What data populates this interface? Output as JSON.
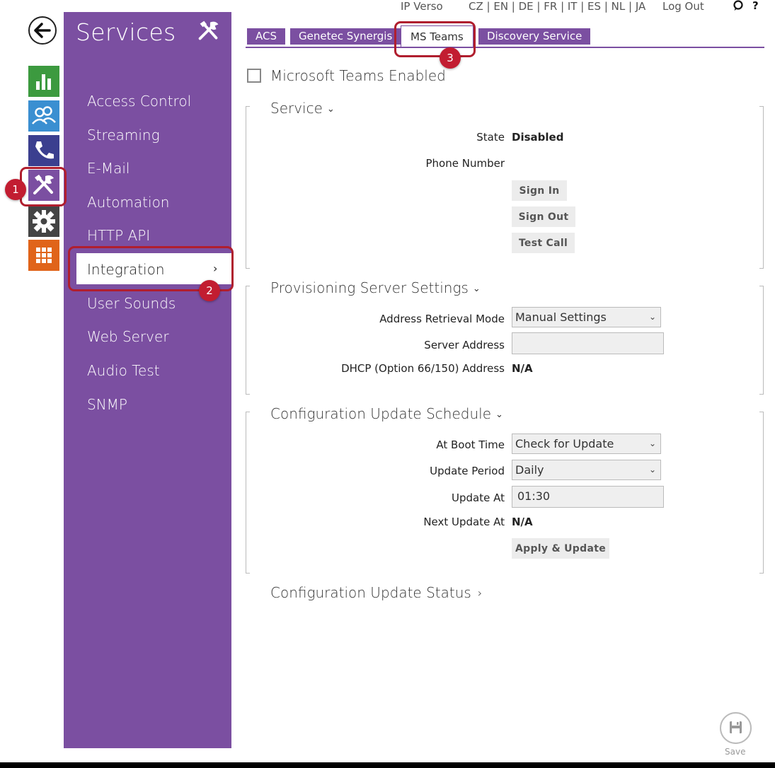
{
  "topbar": {
    "product": "IP Verso",
    "languages": "CZ | EN | DE | FR | IT | ES | NL | JA",
    "logout": "Log Out",
    "feedback_icon": "speech-bubble-icon",
    "help": "?"
  },
  "rail": {
    "back_icon": "back-arrow-icon",
    "items": [
      {
        "icon": "status-chart-icon",
        "color": "#3c9a3f"
      },
      {
        "icon": "directory-users-icon",
        "color": "#3a8fd1"
      },
      {
        "icon": "phone-icon",
        "color": "#3b3f8f"
      },
      {
        "icon": "services-tools-icon",
        "color": "#7b4fa1"
      },
      {
        "icon": "hardware-gear-icon",
        "color": "#444444"
      },
      {
        "icon": "system-grid-icon",
        "color": "#e0641a"
      }
    ]
  },
  "sidebar": {
    "title": "Services",
    "items": [
      {
        "label": "Access Control"
      },
      {
        "label": "Streaming"
      },
      {
        "label": "E-Mail"
      },
      {
        "label": "Automation"
      },
      {
        "label": "HTTP API"
      },
      {
        "label": "Integration",
        "active": true
      },
      {
        "label": "User Sounds"
      },
      {
        "label": "Web Server"
      },
      {
        "label": "Audio Test"
      },
      {
        "label": "SNMP"
      }
    ],
    "active_chevron": "›"
  },
  "tabs": [
    {
      "label": "ACS"
    },
    {
      "label": "Genetec Synergis"
    },
    {
      "label": "MS Teams",
      "active": true
    },
    {
      "label": "Discovery Service"
    }
  ],
  "annotations": [
    "1",
    "2",
    "3"
  ],
  "main": {
    "enabled_label": "Microsoft Teams Enabled",
    "enabled_checked": false,
    "service": {
      "title": "Service",
      "state_label": "State",
      "state_value": "Disabled",
      "phone_label": "Phone Number",
      "phone_value": "",
      "sign_in": "Sign In",
      "sign_out": "Sign Out",
      "test_call": "Test Call"
    },
    "provisioning": {
      "title": "Provisioning Server Settings",
      "mode_label": "Address Retrieval Mode",
      "mode_value": "Manual Settings",
      "server_label": "Server Address",
      "server_value": "",
      "dhcp_label": "DHCP (Option 66/150) Address",
      "dhcp_value": "N/A"
    },
    "schedule": {
      "title": "Configuration Update Schedule",
      "boot_label": "At Boot Time",
      "boot_value": "Check for Update",
      "period_label": "Update Period",
      "period_value": "Daily",
      "at_label": "Update At",
      "at_value": "01:30",
      "next_label": "Next Update At",
      "next_value": "N/A",
      "apply": "Apply & Update"
    },
    "status": {
      "title": "Configuration Update Status"
    },
    "save": "Save"
  }
}
